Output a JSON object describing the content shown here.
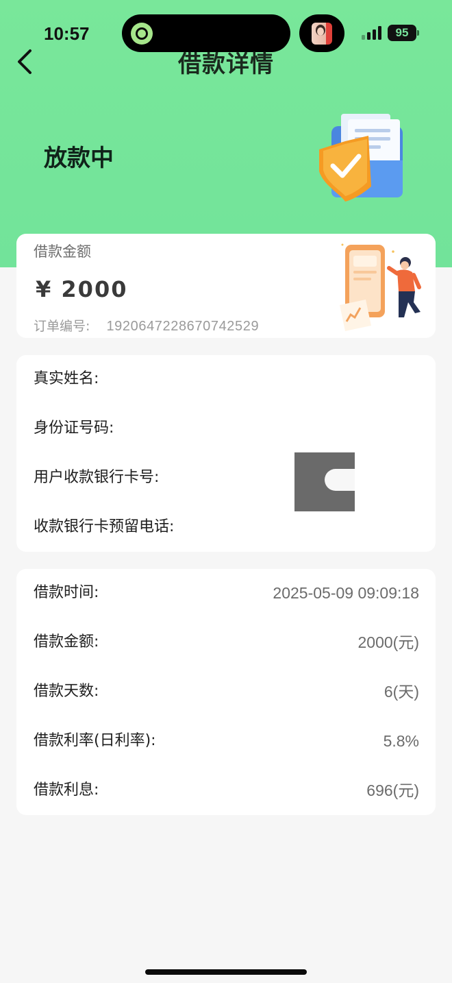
{
  "status_bar": {
    "time": "10:57",
    "battery": "95"
  },
  "nav": {
    "title": "借款详情"
  },
  "hero": {
    "status": "放款中"
  },
  "amount_card": {
    "label": "借款金额",
    "amount": "¥ 2000",
    "order_label": "订单编号:",
    "order_number": "1920647228670742529"
  },
  "user_info": [
    {
      "label": "真实姓名:",
      "value": ""
    },
    {
      "label": "身份证号码:",
      "value": ""
    },
    {
      "label": "用户收款银行卡号:",
      "value": ""
    },
    {
      "label": "收款银行卡预留电话:",
      "value": ""
    }
  ],
  "loan_info": [
    {
      "label": "借款时间:",
      "value": "2025-05-09 09:09:18"
    },
    {
      "label": "借款金额:",
      "value": "2000(元)"
    },
    {
      "label": "借款天数:",
      "value": "6(天)"
    },
    {
      "label": "借款利率(日利率):",
      "value": "5.8%"
    },
    {
      "label": "借款利息:",
      "value": "696(元)"
    }
  ]
}
